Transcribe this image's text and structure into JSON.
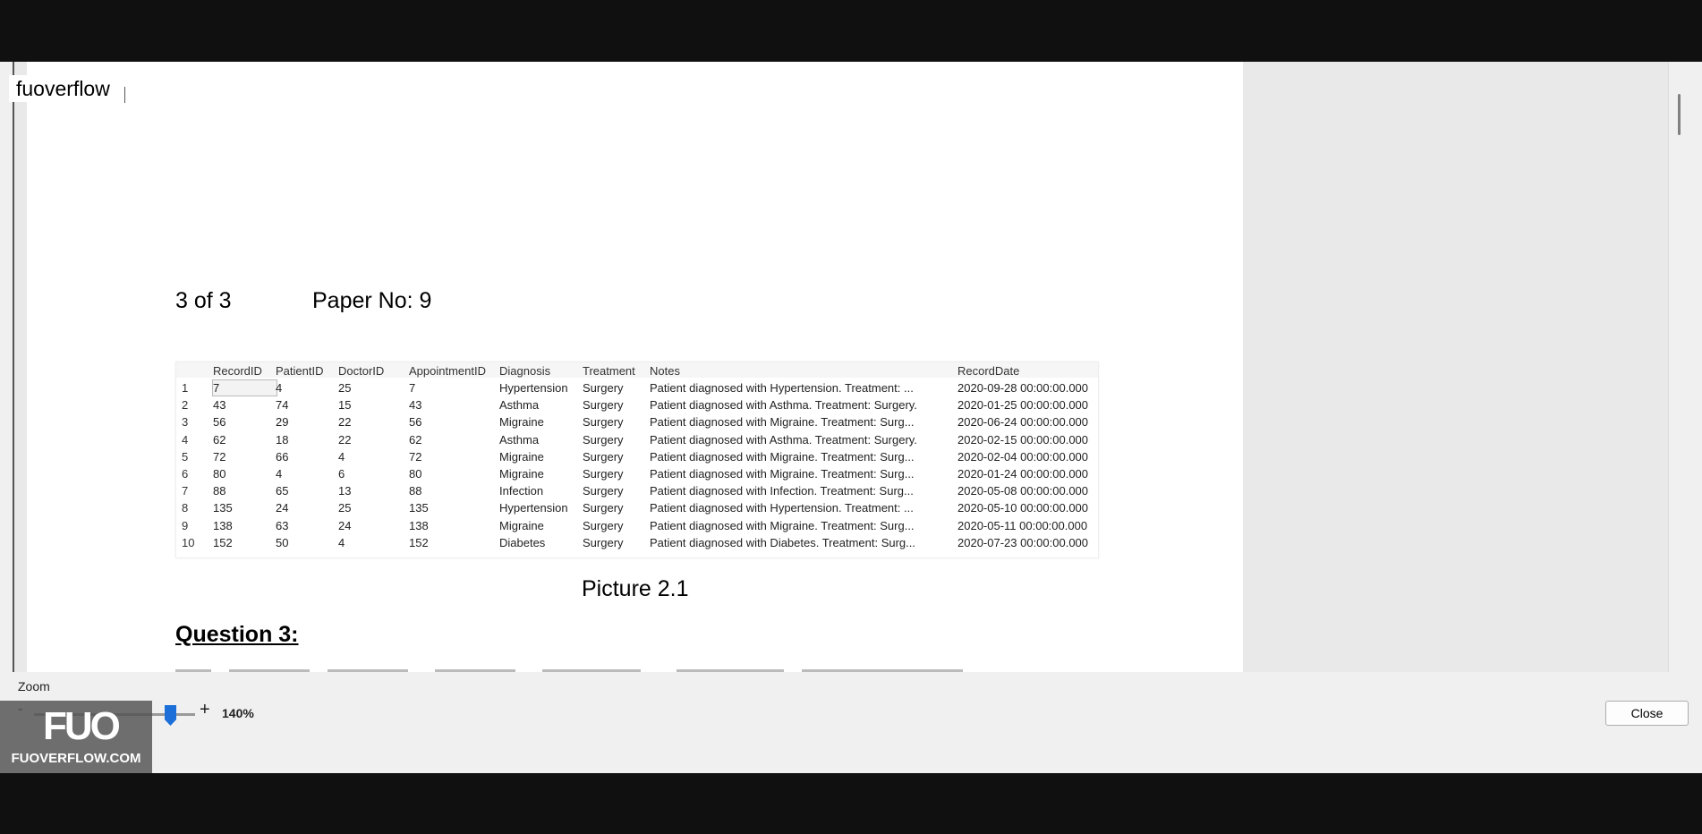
{
  "app": {
    "title": "fuoverflow"
  },
  "paper": {
    "page_count": "3 of 3",
    "paper_no": "Paper No: 9",
    "caption": "Picture 2.1",
    "question_heading": "Question 3:"
  },
  "grid": {
    "headers": [
      "RecordID",
      "PatientID",
      "DoctorID",
      "AppointmentID",
      "Diagnosis",
      "Treatment",
      "Notes",
      "RecordDate"
    ],
    "rows": [
      {
        "n": "1",
        "cells": [
          "7",
          "4",
          "25",
          "7",
          "Hypertension",
          "Surgery",
          "Patient diagnosed with Hypertension. Treatment: ...",
          "2020-09-28 00:00:00.000"
        ]
      },
      {
        "n": "2",
        "cells": [
          "43",
          "74",
          "15",
          "43",
          "Asthma",
          "Surgery",
          "Patient diagnosed with Asthma. Treatment: Surgery.",
          "2020-01-25 00:00:00.000"
        ]
      },
      {
        "n": "3",
        "cells": [
          "56",
          "29",
          "22",
          "56",
          "Migraine",
          "Surgery",
          "Patient diagnosed with Migraine. Treatment: Surg...",
          "2020-06-24 00:00:00.000"
        ]
      },
      {
        "n": "4",
        "cells": [
          "62",
          "18",
          "22",
          "62",
          "Asthma",
          "Surgery",
          "Patient diagnosed with Asthma. Treatment: Surgery.",
          "2020-02-15 00:00:00.000"
        ]
      },
      {
        "n": "5",
        "cells": [
          "72",
          "66",
          "4",
          "72",
          "Migraine",
          "Surgery",
          "Patient diagnosed with Migraine. Treatment: Surg...",
          "2020-02-04 00:00:00.000"
        ]
      },
      {
        "n": "6",
        "cells": [
          "80",
          "4",
          "6",
          "80",
          "Migraine",
          "Surgery",
          "Patient diagnosed with Migraine. Treatment: Surg...",
          "2020-01-24 00:00:00.000"
        ]
      },
      {
        "n": "7",
        "cells": [
          "88",
          "65",
          "13",
          "88",
          "Infection",
          "Surgery",
          "Patient diagnosed with Infection. Treatment: Surg...",
          "2020-05-08 00:00:00.000"
        ]
      },
      {
        "n": "8",
        "cells": [
          "135",
          "24",
          "25",
          "135",
          "Hypertension",
          "Surgery",
          "Patient diagnosed with Hypertension. Treatment: ...",
          "2020-05-10 00:00:00.000"
        ]
      },
      {
        "n": "9",
        "cells": [
          "138",
          "63",
          "24",
          "138",
          "Migraine",
          "Surgery",
          "Patient diagnosed with Migraine. Treatment: Surg...",
          "2020-05-11 00:00:00.000"
        ]
      },
      {
        "n": "10",
        "cells": [
          "152",
          "50",
          "4",
          "152",
          "Diabetes",
          "Surgery",
          "Patient diagnosed with Diabetes. Treatment: Surg...",
          "2020-07-23 00:00:00.000"
        ]
      }
    ]
  },
  "zoom": {
    "label": "Zoom",
    "minus": "-",
    "plus": "+",
    "value": "140%"
  },
  "buttons": {
    "close": "Close"
  },
  "watermark": {
    "mark": "FUO",
    "text": "FUOVERFLOW.COM"
  }
}
